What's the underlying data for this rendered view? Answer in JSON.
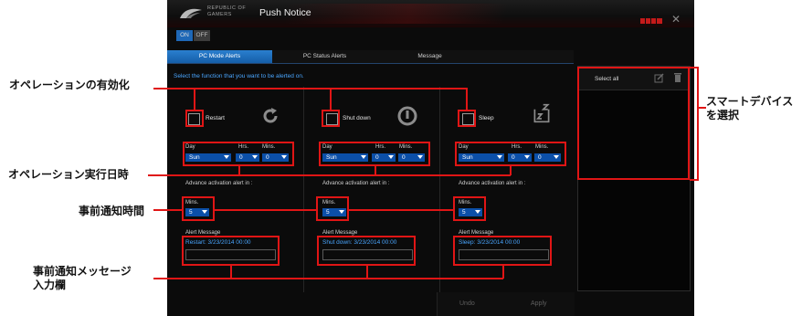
{
  "window": {
    "brand_line1": "REPUBLIC OF",
    "brand_line2": "GAMERS",
    "title": "Push Notice",
    "toggle_on": "ON",
    "toggle_off": "OFF",
    "close_glyph": "✕"
  },
  "tabs": [
    {
      "label": "PC Mode Alerts",
      "active": true
    },
    {
      "label": "PC Status Alerts",
      "active": false
    },
    {
      "label": "Message",
      "active": false
    }
  ],
  "hint": "Select the function that you want to be alerted on.",
  "columns": [
    {
      "option": "Restart",
      "icon": "restart-icon",
      "day": "Sun",
      "hrs": "0",
      "mins": "0",
      "alert_mins": "5",
      "message": "Restart: 3/23/2014 00:00"
    },
    {
      "option": "Shut down",
      "icon": "power-icon",
      "day": "Sun",
      "hrs": "0",
      "mins": "0",
      "alert_mins": "5",
      "message": "Shut down: 3/23/2014 00:00"
    },
    {
      "option": "Sleep",
      "icon": "sleep-icon",
      "day": "Sun",
      "hrs": "0",
      "mins": "0",
      "alert_mins": "5",
      "message": "Sleep: 3/23/2014 00:00"
    }
  ],
  "labels": {
    "day": "Day",
    "hrs": "Hrs.",
    "mins": "Mins.",
    "advance": "Advance activation alert in :",
    "alert_mins": "Mins.",
    "alert_message": "Alert Message"
  },
  "panel": {
    "select_all": "Select all"
  },
  "buttons": {
    "undo": "Undo",
    "apply": "Apply"
  },
  "annotations": {
    "enable": "オペレーションの有効化",
    "datetime": "オペレーション実行日時",
    "notice_time": "事前通知時間",
    "notice_msg_line1": "事前通知メッセージ",
    "notice_msg_line2": "入力欄",
    "device_line1": "スマートデバイス",
    "device_line2": "を選択"
  },
  "colors": {
    "accent": "#1e68b7",
    "highlight": "#e01515",
    "link": "#4aa6ff"
  }
}
